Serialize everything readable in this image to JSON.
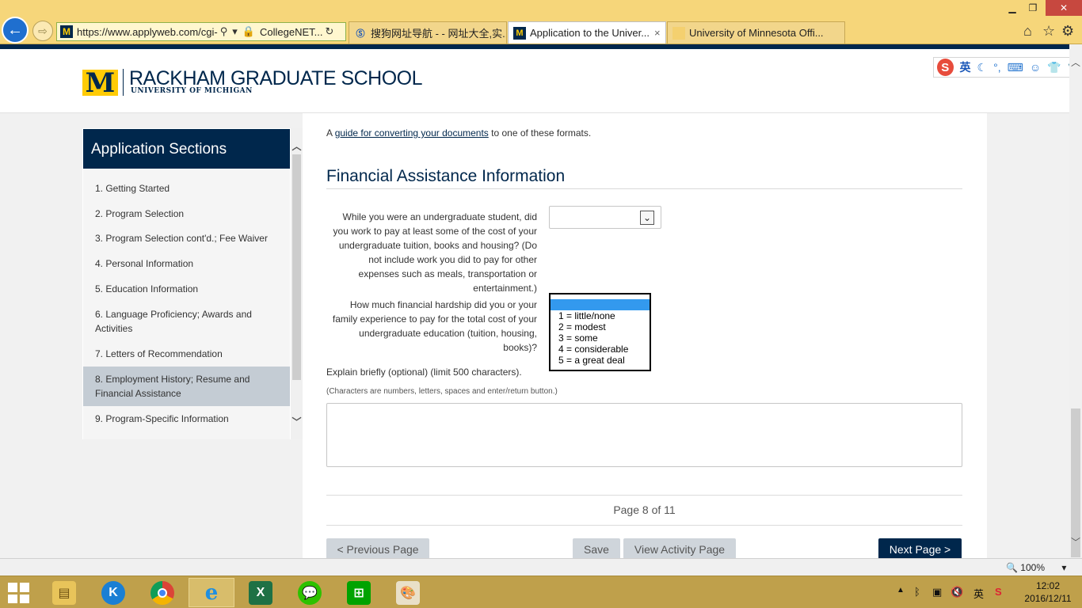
{
  "browser": {
    "address": {
      "url_main": "https://www.applyweb.com/cgi-",
      "site_name": "CollegeNET..."
    },
    "tabs": [
      {
        "label": "搜狗网址导航 - - 网址大全,实...",
        "active": false
      },
      {
        "label": "Application to the Univer...",
        "active": true,
        "close": "×"
      },
      {
        "label": "University of Minnesota Offi...",
        "active": false
      }
    ]
  },
  "header": {
    "logo_letter": "M",
    "title": "RACKHAM GRADUATE SCHOOL",
    "subtitle": "UNIVERSITY OF MICHIGAN"
  },
  "ime": {
    "lang": "英"
  },
  "sidebar": {
    "title": "Application Sections",
    "items": [
      {
        "label": "1. Getting Started"
      },
      {
        "label": "2. Program Selection"
      },
      {
        "label": "3. Program Selection cont'd.; Fee Waiver"
      },
      {
        "label": "4. Personal Information"
      },
      {
        "label": "5. Education Information"
      },
      {
        "label": "6. Language Proficiency; Awards and Activities"
      },
      {
        "label": "7. Letters of Recommendation"
      },
      {
        "label": "8. Employment History; Resume and Financial Assistance",
        "active": true
      },
      {
        "label": "9. Program-Specific Information"
      }
    ]
  },
  "main": {
    "guide_prefix": "A ",
    "guide_link": "guide for converting your documents",
    "guide_suffix": " to one of these formats.",
    "section_title": "Financial Assistance Information",
    "q1_text": "While you were an undergraduate student, did you work to pay at least some of the cost of your undergraduate tuition, books and housing? (Do not include work you did to pay for other expenses such as meals, transportation or entertainment.)",
    "q1_value": "",
    "q2_text": "How much financial hardship did you or your family experience to pay for the total cost of your undergraduate education (tuition, housing, books)?",
    "q2_options": [
      "",
      "1 = little/none",
      "2 = modest",
      "3 = some",
      "4 = considerable",
      "5 = a great deal"
    ],
    "explain_label": "Explain briefly (optional) (limit 500 characters).",
    "chars_note": "(Characters are numbers, letters, spaces and enter/return button.)",
    "explain_value": "",
    "page_indicator": "Page 8 of 11",
    "buttons": {
      "previous": "< Previous Page",
      "save": "Save",
      "view_activity": "View Activity Page",
      "next": "Next Page >"
    }
  },
  "statusbar": {
    "zoom": "100%"
  },
  "taskbar": {
    "tray_lang": "英",
    "time": "12:02",
    "date": "2016/12/11"
  },
  "colors": {
    "brand_blue": "#00274c",
    "maize": "#ffcb05",
    "selection_blue": "#3399ee",
    "sidebar_active": "#c4ccd4"
  }
}
